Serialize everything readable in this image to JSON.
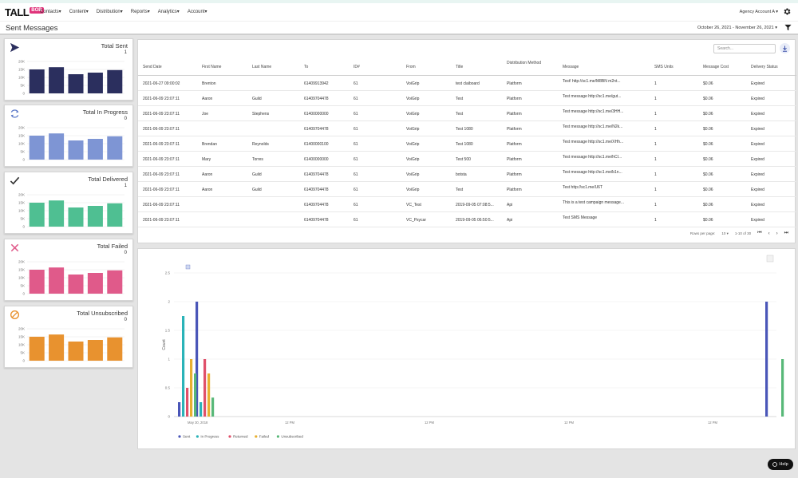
{
  "app": {
    "logo_text": "TALL",
    "logo_badge": "BOB",
    "nav": [
      "Contacts▾",
      "Content▾",
      "Distribution▾",
      "Reports▾",
      "Analytics▾",
      "Account▾"
    ],
    "account_label": "Agency Account A ▾"
  },
  "header": {
    "title": "Sent Messages",
    "date_range": "October 26, 2021 - November 26, 2021 ▾"
  },
  "summary_cards": [
    {
      "title": "Total Sent",
      "value": "1",
      "color": "#2b2f5e",
      "bars": [
        0.75,
        0.82,
        0.6,
        0.65,
        0.73
      ],
      "ticks": [
        "20K",
        "15K",
        "10K",
        "5K",
        "0"
      ]
    },
    {
      "title": "Total In Progress",
      "value": "0",
      "color": "#7e95d4",
      "bars": [
        0.75,
        0.82,
        0.6,
        0.65,
        0.73
      ],
      "ticks": [
        "20K",
        "15K",
        "10K",
        "5K",
        "0"
      ]
    },
    {
      "title": "Total Delivered",
      "value": "1",
      "color": "#4fbf92",
      "bars": [
        0.75,
        0.82,
        0.6,
        0.65,
        0.73
      ],
      "ticks": [
        "20K",
        "15K",
        "10K",
        "5K",
        "0"
      ]
    },
    {
      "title": "Total Failed",
      "value": "0",
      "color": "#e05a8a",
      "bars": [
        0.75,
        0.82,
        0.6,
        0.65,
        0.73
      ],
      "ticks": [
        "20K",
        "15K",
        "10K",
        "5K",
        "0"
      ]
    },
    {
      "title": "Total Unsubscribed",
      "value": "0",
      "color": "#e8922f",
      "bars": [
        0.75,
        0.82,
        0.6,
        0.65,
        0.73
      ],
      "ticks": [
        "20K",
        "15K",
        "10K",
        "5K",
        "0"
      ]
    }
  ],
  "table": {
    "search_placeholder": "Search...",
    "columns": [
      "Send Date",
      "First Name",
      "Last Name",
      "To",
      "ID#",
      "From",
      "Title",
      "Distribution Method",
      "Message",
      "SMS Units",
      "Message Cost",
      "Delivery Status"
    ],
    "rows": [
      [
        "2021-06-27 09:00:02",
        "Brenton",
        "",
        "61409913942",
        "61",
        "VoiGrip",
        "test claiboard",
        "Platform",
        "Test! http://sc1.me/M8BN m2nt...",
        "1",
        "$0.06",
        "Expired"
      ],
      [
        "2021-06-09 23:07:11",
        "Aaron",
        "Guild",
        "61409704478",
        "61",
        "VoiGrip",
        "Test",
        "Platform",
        "Test message http://sc1.me/gut...",
        "1",
        "$0.06",
        "Expired"
      ],
      [
        "2021-06-09 23:07:11",
        "Joe",
        "Stephens",
        "61400000000",
        "61",
        "VoiGrip",
        "Test",
        "Platform",
        "Test message http://sc1.me/3HH...",
        "1",
        "$0.06",
        "Expired"
      ],
      [
        "2021-06-09 23:07:11",
        "",
        "",
        "61409704478",
        "61",
        "VoiGrip",
        "Test 1080",
        "Platform",
        "Test message http://sc1.me/N2k...",
        "1",
        "$0.06",
        "Expired"
      ],
      [
        "2021-06-09 23:07:11",
        "Brendan",
        "Reynolds",
        "61400000100",
        "61",
        "VoiGrip",
        "Test 1080",
        "Platform",
        "Test message http://sc1.me/XHh...",
        "1",
        "$0.06",
        "Expired"
      ],
      [
        "2021-06-09 23:07:11",
        "Mary",
        "Torres",
        "61400000000",
        "61",
        "VoiGrip",
        "Test 500",
        "Platform",
        "Test message http://sc1.me/hCI...",
        "1",
        "$0.06",
        "Expired"
      ],
      [
        "2021-06-09 23:07:11",
        "Aaron",
        "Guild",
        "61409704478",
        "61",
        "VoiGrip",
        "botsta",
        "Platform",
        "Test message http://sc1.me/b1n...",
        "1",
        "$0.06",
        "Expired"
      ],
      [
        "2021-06-09 23:07:11",
        "Aaron",
        "Guild",
        "61409704478",
        "61",
        "VoiGrip",
        "Test",
        "Platform",
        "Test http://sc1.me/U6T",
        "1",
        "$0.06",
        "Expired"
      ],
      [
        "2021-06-09 23:07:11",
        "",
        "",
        "61409704478",
        "61",
        "VC_Test",
        "2019-09-05 07:08:5...",
        "Api",
        "This is a test campaign message...",
        "1",
        "$0.06",
        "Expired"
      ],
      [
        "2021-06-09 23:07:11",
        "",
        "",
        "61409704478",
        "61",
        "VC_Psycar",
        "2019-09-05 06:50:5...",
        "Api",
        "Test SMS Message",
        "1",
        "$0.06",
        "Expired"
      ]
    ],
    "pagination": {
      "rows_label": "Rows per page:",
      "rows_value": "10 ▾",
      "range": "1-10 of 30"
    }
  },
  "chart_data": {
    "type": "bar",
    "xlabel": "",
    "ylabel": "Count",
    "yticks": [
      "0",
      "0.5",
      "1",
      "1.5",
      "2",
      "2.5"
    ],
    "xticks": [
      "May 30, 2018",
      "12 PM",
      "12 PM",
      "12 PM",
      "12 PM"
    ],
    "ylim": [
      0,
      2
    ],
    "series": [
      {
        "name": "Sent",
        "color": "#4a56b8",
        "values": [
          0.25,
          2.0,
          2.0
        ]
      },
      {
        "name": "In Progress",
        "color": "#2ab3b8",
        "values": [
          1.75,
          0.25,
          0
        ]
      },
      {
        "name": "Returned",
        "color": "#e0506a",
        "values": [
          0.5,
          1.0,
          0
        ]
      },
      {
        "name": "Failed",
        "color": "#e8b030",
        "values": [
          1.0,
          0.75,
          0
        ]
      },
      {
        "name": "Unsubscribed",
        "color": "#58b878",
        "values": [
          0.75,
          0.33,
          1.0
        ]
      }
    ]
  },
  "help_label": "Help"
}
